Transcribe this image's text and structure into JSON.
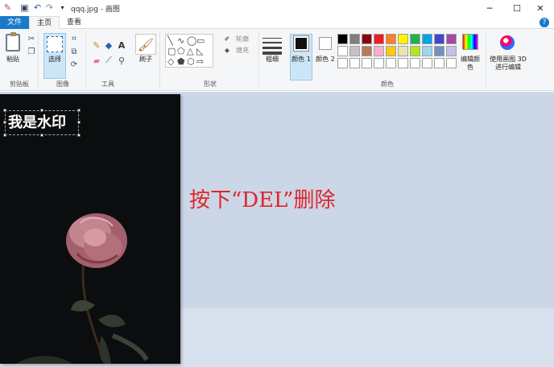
{
  "window": {
    "title": "qqq.jpg - 画图",
    "min_icon": "minimize-icon",
    "max_icon": "maximize-icon",
    "close_icon": "close-icon"
  },
  "tabs": {
    "file": "文件",
    "home": "主页",
    "view": "查看"
  },
  "ribbon": {
    "clipboard": {
      "paste": "粘贴",
      "group": "剪贴板"
    },
    "image": {
      "select": "选择",
      "group": "图像"
    },
    "tools": {
      "group": "工具"
    },
    "brushes": {
      "label": "刷子"
    },
    "shapes": {
      "outline": "轮廓",
      "fill": "填充",
      "group": "形状"
    },
    "size": {
      "label": "粗细"
    },
    "color1": {
      "label": "颜色 1"
    },
    "color2": {
      "label": "颜色 2"
    },
    "colors": {
      "group": "颜色",
      "edit": "编辑颜色",
      "paint3d": "使用画图 3D 进行编辑",
      "row1": [
        "#000000",
        "#7f7f7f",
        "#880015",
        "#ed1c24",
        "#ff7f27",
        "#fff200",
        "#22b14c",
        "#00a2e8",
        "#3f48cc",
        "#a349a4"
      ],
      "row2": [
        "#ffffff",
        "#c3c3c3",
        "#b97a57",
        "#ffaec9",
        "#ffc90e",
        "#efe4b0",
        "#b5e61d",
        "#99d9ea",
        "#7092be",
        "#c8bfe7"
      ],
      "row3": [
        "#ffffff",
        "#ffffff",
        "#ffffff",
        "#ffffff",
        "#ffffff",
        "#ffffff",
        "#ffffff",
        "#ffffff",
        "#ffffff",
        "#ffffff"
      ]
    }
  },
  "canvas": {
    "watermark": "我是水印"
  },
  "annotation": "按下“DEL”删除"
}
